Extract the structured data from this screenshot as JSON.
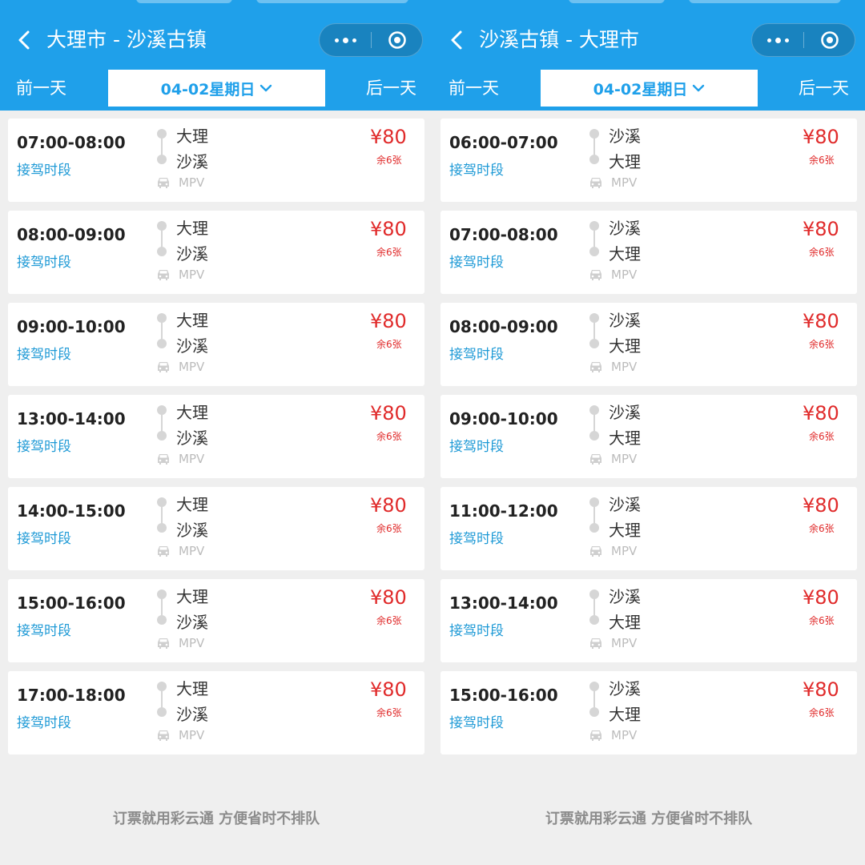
{
  "left": {
    "title": "大理市 - 沙溪古镇",
    "prev_day": "前一天",
    "next_day": "后一天",
    "date": "04-02星期日",
    "footer": "订票就用彩云通 方便省时不排队",
    "trips": [
      {
        "time": "07:00-08:00",
        "period": "接驾时段",
        "from": "大理",
        "to": "沙溪",
        "vehicle": "MPV",
        "price": "¥80",
        "remain": "余6张"
      },
      {
        "time": "08:00-09:00",
        "period": "接驾时段",
        "from": "大理",
        "to": "沙溪",
        "vehicle": "MPV",
        "price": "¥80",
        "remain": "余6张"
      },
      {
        "time": "09:00-10:00",
        "period": "接驾时段",
        "from": "大理",
        "to": "沙溪",
        "vehicle": "MPV",
        "price": "¥80",
        "remain": "余6张"
      },
      {
        "time": "13:00-14:00",
        "period": "接驾时段",
        "from": "大理",
        "to": "沙溪",
        "vehicle": "MPV",
        "price": "¥80",
        "remain": "余6张"
      },
      {
        "time": "14:00-15:00",
        "period": "接驾时段",
        "from": "大理",
        "to": "沙溪",
        "vehicle": "MPV",
        "price": "¥80",
        "remain": "余6张"
      },
      {
        "time": "15:00-16:00",
        "period": "接驾时段",
        "from": "大理",
        "to": "沙溪",
        "vehicle": "MPV",
        "price": "¥80",
        "remain": "余6张"
      },
      {
        "time": "17:00-18:00",
        "period": "接驾时段",
        "from": "大理",
        "to": "沙溪",
        "vehicle": "MPV",
        "price": "¥80",
        "remain": "余6张"
      }
    ]
  },
  "right": {
    "title": "沙溪古镇 - 大理市",
    "prev_day": "前一天",
    "next_day": "后一天",
    "date": "04-02星期日",
    "footer": "订票就用彩云通 方便省时不排队",
    "trips": [
      {
        "time": "06:00-07:00",
        "period": "接驾时段",
        "from": "沙溪",
        "to": "大理",
        "vehicle": "MPV",
        "price": "¥80",
        "remain": "余6张"
      },
      {
        "time": "07:00-08:00",
        "period": "接驾时段",
        "from": "沙溪",
        "to": "大理",
        "vehicle": "MPV",
        "price": "¥80",
        "remain": "余6张"
      },
      {
        "time": "08:00-09:00",
        "period": "接驾时段",
        "from": "沙溪",
        "to": "大理",
        "vehicle": "MPV",
        "price": "¥80",
        "remain": "余6张"
      },
      {
        "time": "09:00-10:00",
        "period": "接驾时段",
        "from": "沙溪",
        "to": "大理",
        "vehicle": "MPV",
        "price": "¥80",
        "remain": "余6张"
      },
      {
        "time": "11:00-12:00",
        "period": "接驾时段",
        "from": "沙溪",
        "to": "大理",
        "vehicle": "MPV",
        "price": "¥80",
        "remain": "余6张"
      },
      {
        "time": "13:00-14:00",
        "period": "接驾时段",
        "from": "沙溪",
        "to": "大理",
        "vehicle": "MPV",
        "price": "¥80",
        "remain": "余6张"
      },
      {
        "time": "15:00-16:00",
        "period": "接驾时段",
        "from": "沙溪",
        "to": "大理",
        "vehicle": "MPV",
        "price": "¥80",
        "remain": "余6张"
      }
    ]
  },
  "colors": {
    "header_blue": "#1fa0ea",
    "price_red": "#e02a2a",
    "period_blue": "#1f9ad6",
    "background": "#efefef"
  },
  "icons": {
    "back": "chevron-left-icon",
    "more": "more-dots-icon",
    "close": "target-icon",
    "dropdown": "chevron-down-icon",
    "route": "route-dots-icon",
    "car": "car-icon"
  }
}
